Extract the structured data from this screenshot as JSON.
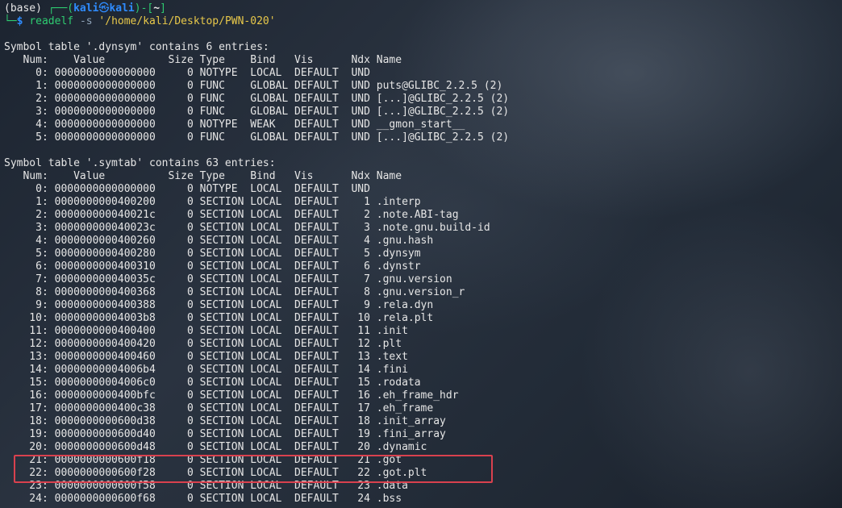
{
  "prompt": {
    "env": "(base)",
    "box_open": "┌──(",
    "user": "kali",
    "at": "㉿",
    "host": "kali",
    "mid": ")-[",
    "dir": "~",
    "close": "]",
    "line2_prefix": "└─",
    "symbol": "$",
    "command": "readelf",
    "flag": "-s",
    "path": "'/home/kali/Desktop/PWN-020'"
  },
  "dynsym": {
    "title": "Symbol table '.dynsym' contains 6 entries:",
    "header": "   Num:    Value          Size Type    Bind   Vis      Ndx Name",
    "rows": [
      "     0: 0000000000000000     0 NOTYPE  LOCAL  DEFAULT  UND ",
      "     1: 0000000000000000     0 FUNC    GLOBAL DEFAULT  UND puts@GLIBC_2.2.5 (2)",
      "     2: 0000000000000000     0 FUNC    GLOBAL DEFAULT  UND [...]@GLIBC_2.2.5 (2)",
      "     3: 0000000000000000     0 FUNC    GLOBAL DEFAULT  UND [...]@GLIBC_2.2.5 (2)",
      "     4: 0000000000000000     0 NOTYPE  WEAK   DEFAULT  UND __gmon_start__",
      "     5: 0000000000000000     0 FUNC    GLOBAL DEFAULT  UND [...]@GLIBC_2.2.5 (2)"
    ]
  },
  "symtab": {
    "title": "Symbol table '.symtab' contains 63 entries:",
    "header": "   Num:    Value          Size Type    Bind   Vis      Ndx Name",
    "rows": [
      "     0: 0000000000000000     0 NOTYPE  LOCAL  DEFAULT  UND ",
      "     1: 0000000000400200     0 SECTION LOCAL  DEFAULT    1 .interp",
      "     2: 000000000040021c     0 SECTION LOCAL  DEFAULT    2 .note.ABI-tag",
      "     3: 000000000040023c     0 SECTION LOCAL  DEFAULT    3 .note.gnu.build-id",
      "     4: 0000000000400260     0 SECTION LOCAL  DEFAULT    4 .gnu.hash",
      "     5: 0000000000400280     0 SECTION LOCAL  DEFAULT    5 .dynsym",
      "     6: 0000000000400310     0 SECTION LOCAL  DEFAULT    6 .dynstr",
      "     7: 000000000040035c     0 SECTION LOCAL  DEFAULT    7 .gnu.version",
      "     8: 0000000000400368     0 SECTION LOCAL  DEFAULT    8 .gnu.version_r",
      "     9: 0000000000400388     0 SECTION LOCAL  DEFAULT    9 .rela.dyn",
      "    10: 00000000004003b8     0 SECTION LOCAL  DEFAULT   10 .rela.plt",
      "    11: 0000000000400400     0 SECTION LOCAL  DEFAULT   11 .init",
      "    12: 0000000000400420     0 SECTION LOCAL  DEFAULT   12 .plt",
      "    13: 0000000000400460     0 SECTION LOCAL  DEFAULT   13 .text",
      "    14: 00000000004006b4     0 SECTION LOCAL  DEFAULT   14 .fini",
      "    15: 00000000004006c0     0 SECTION LOCAL  DEFAULT   15 .rodata",
      "    16: 0000000000400bfc     0 SECTION LOCAL  DEFAULT   16 .eh_frame_hdr",
      "    17: 0000000000400c38     0 SECTION LOCAL  DEFAULT   17 .eh_frame",
      "    18: 0000000000600d38     0 SECTION LOCAL  DEFAULT   18 .init_array",
      "    19: 0000000000600d40     0 SECTION LOCAL  DEFAULT   19 .fini_array",
      "    20: 0000000000600d48     0 SECTION LOCAL  DEFAULT   20 .dynamic",
      "    21: 0000000000600f18     0 SECTION LOCAL  DEFAULT   21 .got",
      "    22: 0000000000600f28     0 SECTION LOCAL  DEFAULT   22 .got.plt",
      "    23: 0000000000600f58     0 SECTION LOCAL  DEFAULT   23 .data",
      "    24: 0000000000600f68     0 SECTION LOCAL  DEFAULT   24 .bss"
    ]
  },
  "highlight": {
    "color": "#d9414e",
    "rows": [
      21,
      22
    ]
  }
}
